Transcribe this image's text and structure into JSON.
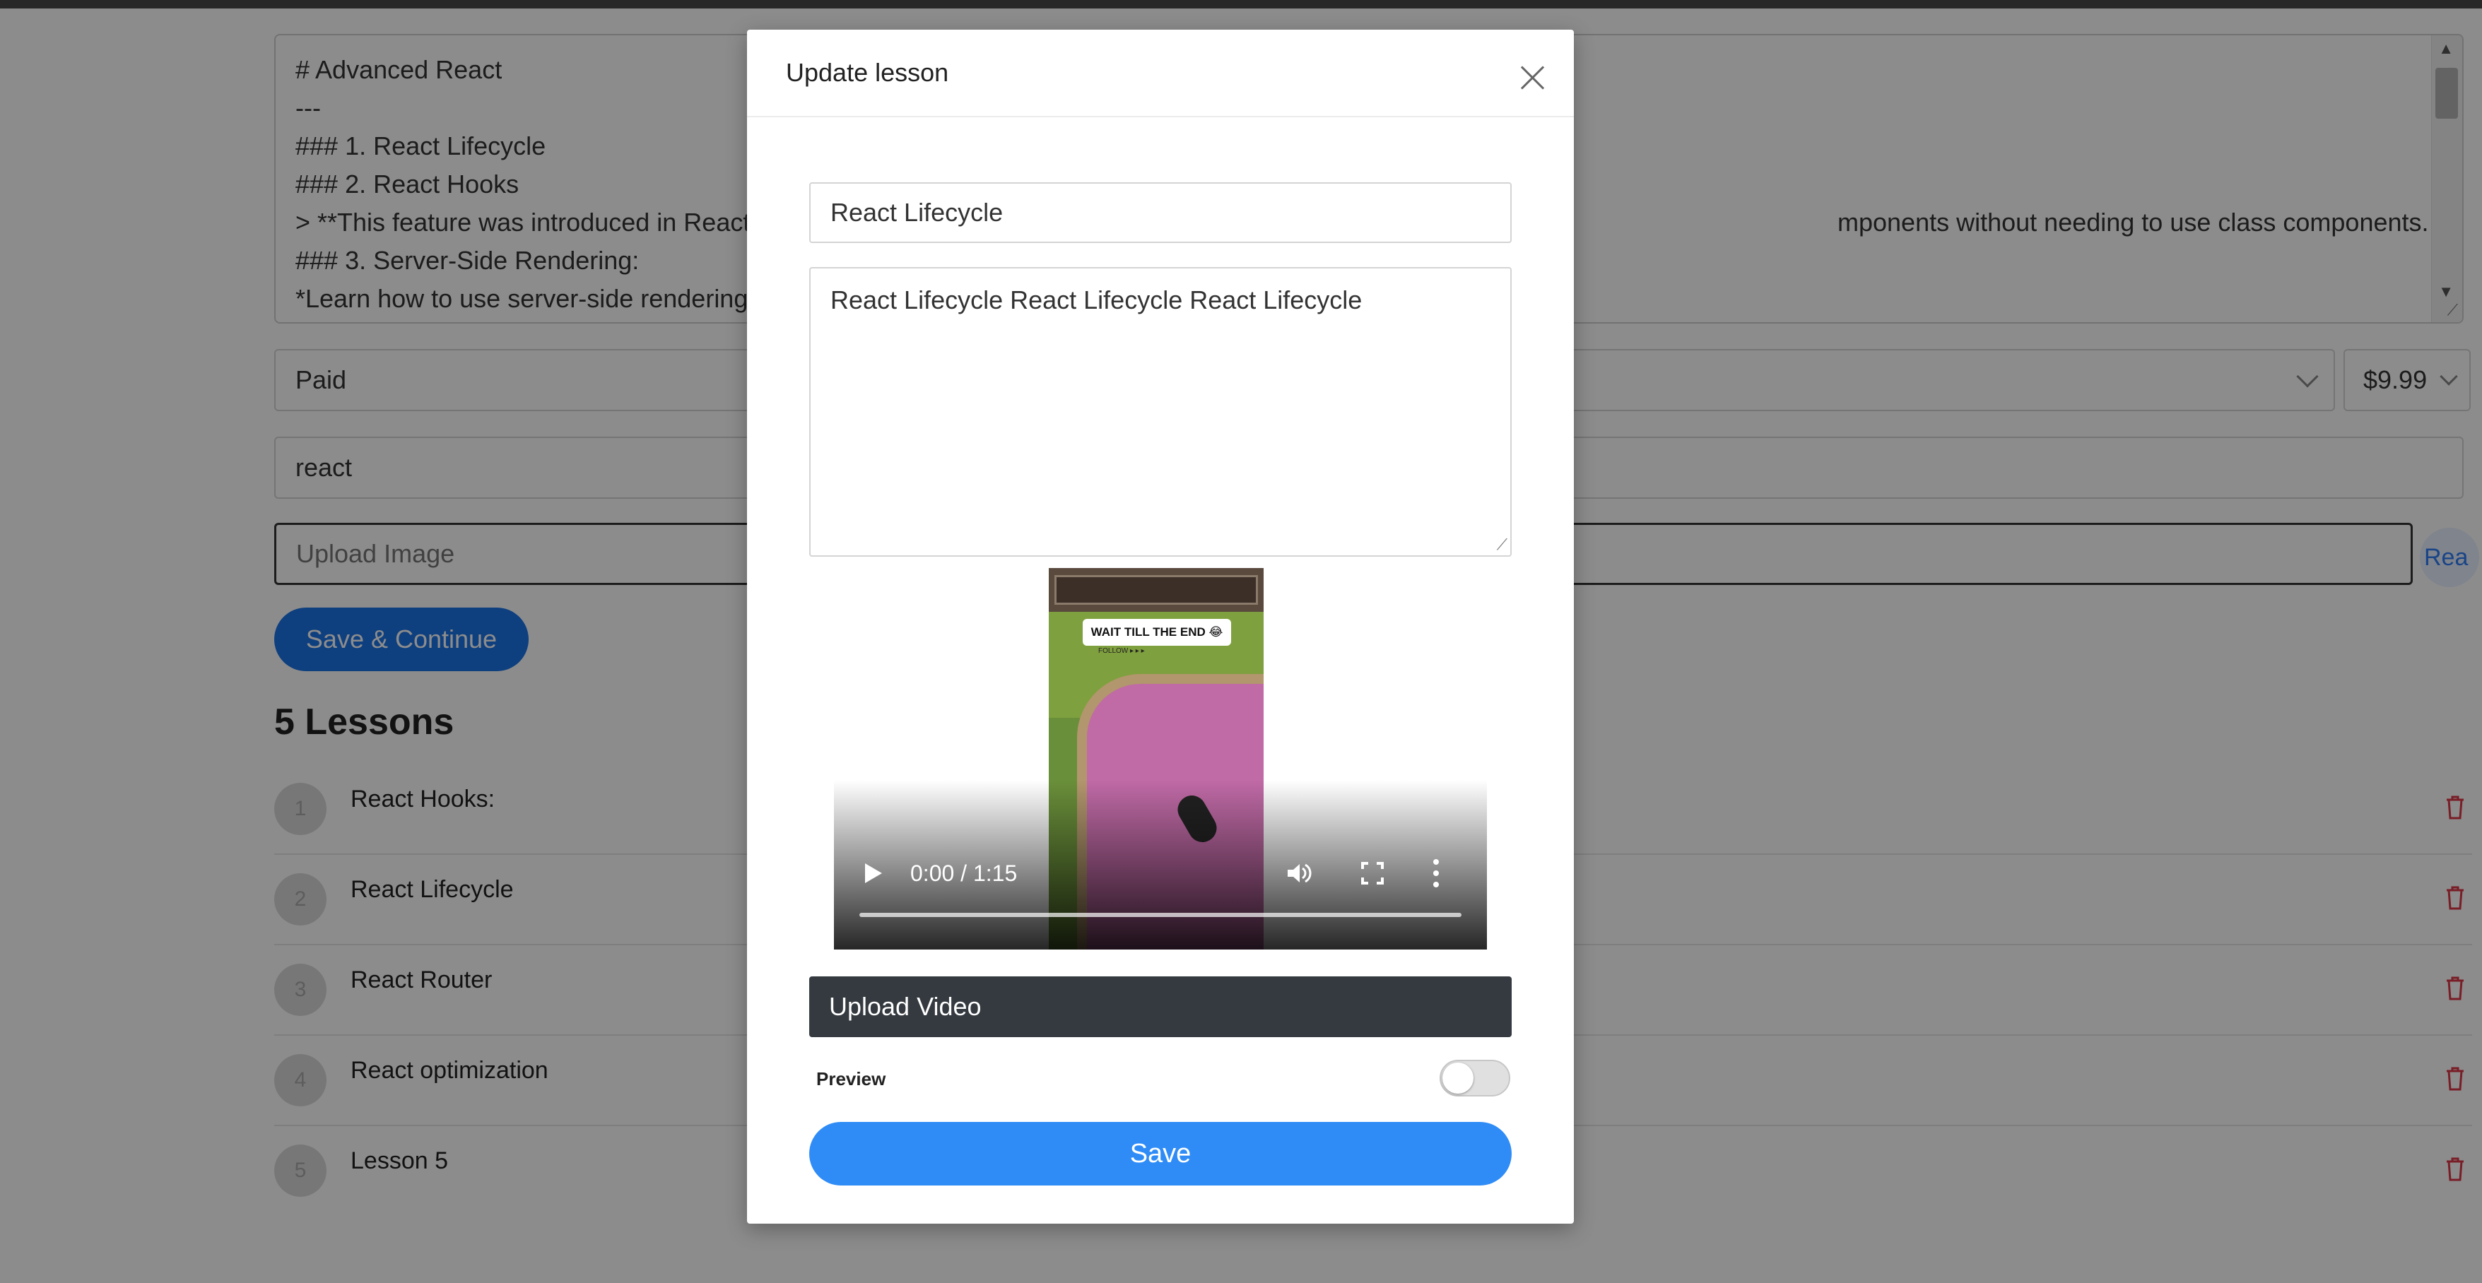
{
  "editor": {
    "lines": [
      "# Advanced React",
      "---",
      "###  1. React Lifecycle",
      "###  2. React Hooks",
      "> **This feature was introduced in React",
      "### 3. Server-Side Rendering:",
      " *Learn how to use server-side rendering"
    ],
    "line_tail": "mponents without needing to use class components. **"
  },
  "pricing": {
    "type_value": "Paid",
    "price_value": "$9.99"
  },
  "tags_value": "react",
  "upload_image_placeholder": "Upload Image",
  "read_link_label": "Rea",
  "save_continue_label": "Save & Continue",
  "lessons": {
    "title": "5 Lessons",
    "items": [
      {
        "num": "1",
        "name": "React Hooks:"
      },
      {
        "num": "2",
        "name": "React Lifecycle"
      },
      {
        "num": "3",
        "name": "React Router"
      },
      {
        "num": "4",
        "name": "React optimization"
      },
      {
        "num": "5",
        "name": "Lesson 5"
      }
    ]
  },
  "modal": {
    "title": "Update lesson",
    "lesson_title_value": "React Lifecycle",
    "lesson_description_value": "React Lifecycle React Lifecycle React Lifecycle",
    "video": {
      "caption": "WAIT TILL THE END 😂",
      "sub_caption": "FOLLOW ▸ ▸ ▸",
      "time": "0:00 / 1:15",
      "progress": 0.0
    },
    "upload_video_label": "Upload Video",
    "preview_label": "Preview",
    "preview_enabled": false,
    "save_label": "Save"
  },
  "colors": {
    "primary": "#1a73e8",
    "save": "#2f8cf6",
    "dark_button": "#343a40",
    "danger": "#dc3545"
  }
}
